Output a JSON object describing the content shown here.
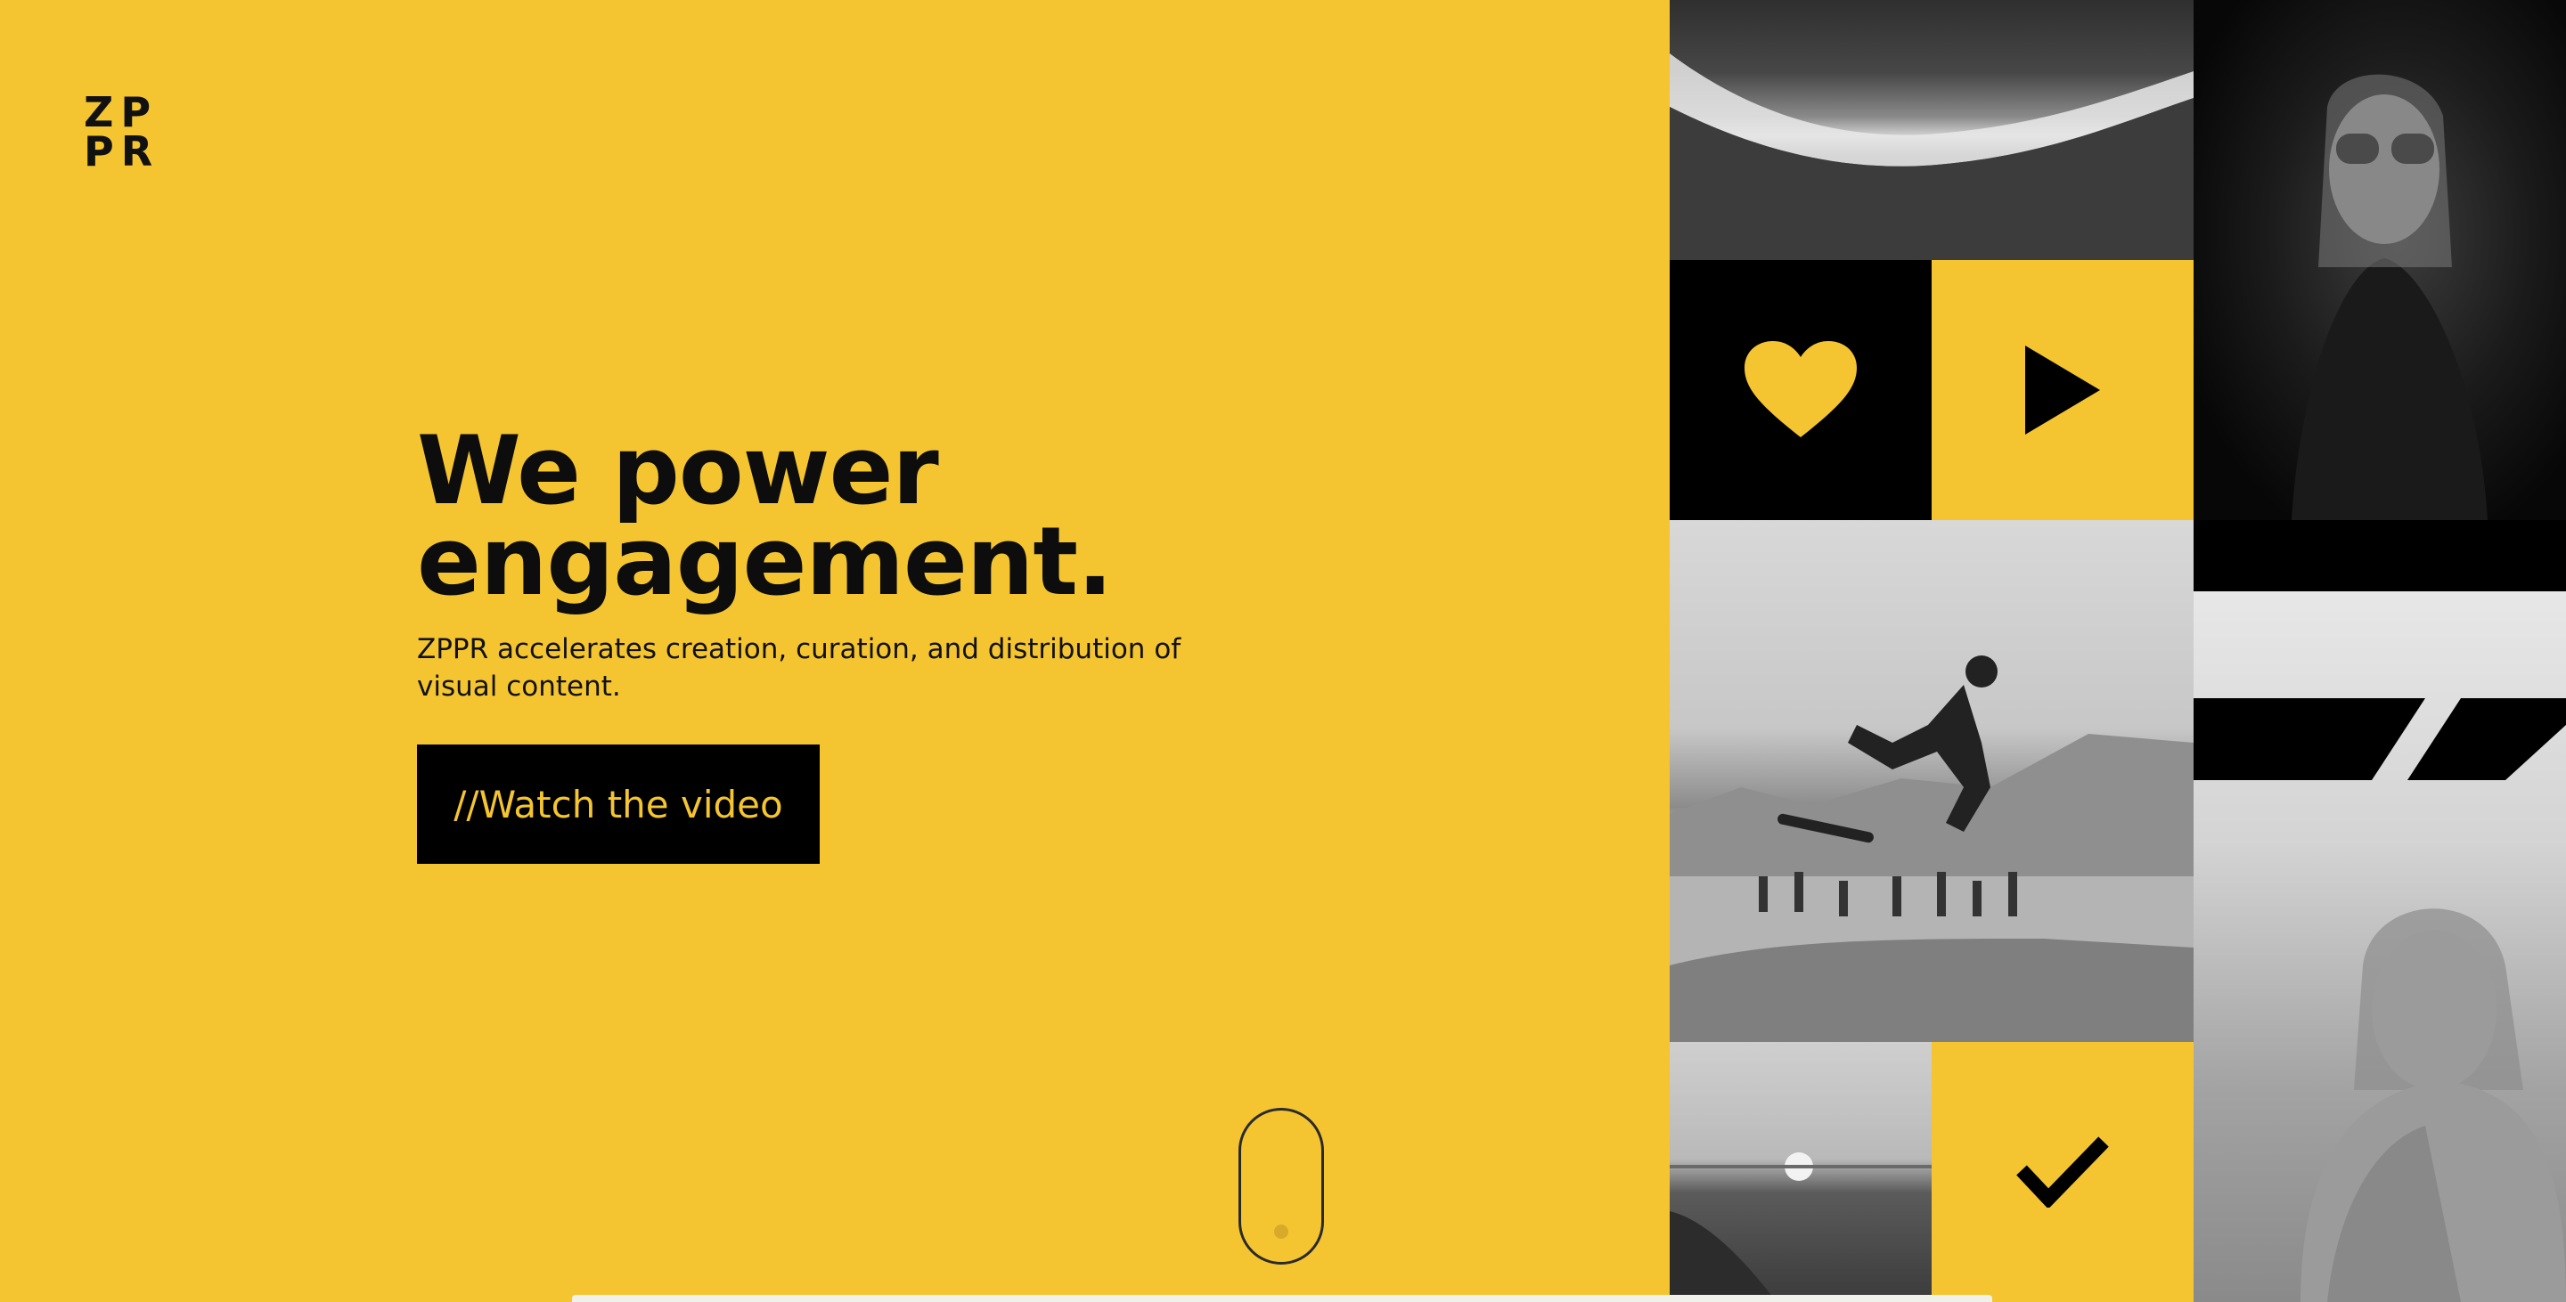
{
  "brand": {
    "logo_line1": "ZP",
    "logo_line2": "PR"
  },
  "hero": {
    "headline_line1": "We power",
    "headline_line2": "engagement.",
    "subtext": "ZPPR accelerates creation, curation, and distribution of visual content.",
    "cta_label": "//Watch the video"
  },
  "colors": {
    "accent": "#F4C531",
    "dark": "#000000"
  },
  "grid": {
    "icons": [
      "heart-icon",
      "play-icon",
      "check-icon"
    ],
    "photos": [
      "ocean-shore-photo",
      "woman-sunglasses-photo",
      "skateboarder-photo",
      "sea-horizon-photo",
      "woman-blanket-photo"
    ]
  }
}
